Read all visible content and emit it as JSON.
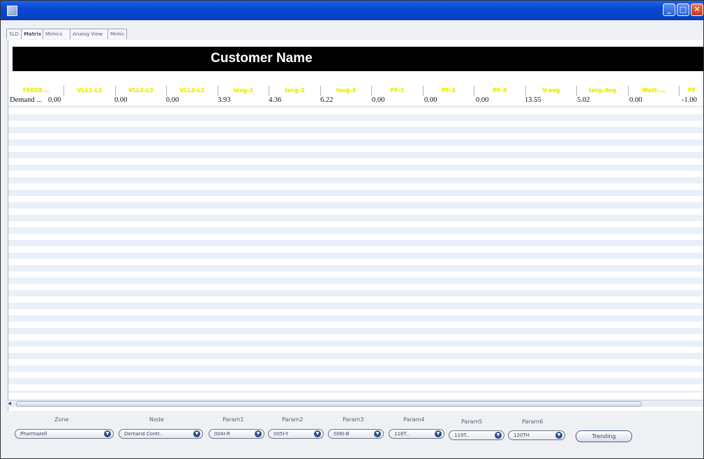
{
  "window": {
    "close_glyph": "✕",
    "min_glyph": "_",
    "max_glyph": "□"
  },
  "tabs": [
    "SLD",
    "Matrix",
    "Mimics",
    "Analog View",
    "Mimic"
  ],
  "active_tab": 1,
  "banner": {
    "title": "Customer Name"
  },
  "table": {
    "columns": [
      "FEEDE...",
      "VLL1-L2",
      "VLL2-L3",
      "VLL3-L1",
      "Iavg-1",
      "Iavg-2",
      "Iavg-3",
      "PF-1",
      "PF-2",
      "PF-3",
      "V-avg",
      "Iavg-Avg",
      "Watt-...",
      "PF"
    ],
    "rows": [
      [
        "Demand ...",
        "0.00",
        "0.00",
        "0.00",
        "3.93",
        "4.36",
        "6.22",
        "0.00",
        "0.00",
        "0.00",
        "13.55",
        "5.02",
        "0.00",
        "-1.00"
      ]
    ]
  },
  "controls": {
    "zone": {
      "label": "Zone",
      "value": "Pharmazell"
    },
    "node": {
      "label": "Node",
      "value": "Demand Contr.."
    },
    "param1": {
      "label": "Param1",
      "value": "004I-R"
    },
    "param2": {
      "label": "Param2",
      "value": "005I-Y"
    },
    "param3": {
      "label": "Param3",
      "value": "006I-B"
    },
    "param4": {
      "label": "Param4",
      "value": "118T.."
    },
    "param5": {
      "label": "Param5",
      "value": "119T.."
    },
    "param6": {
      "label": "Param6",
      "value": "120TH"
    },
    "trending_label": "Trending"
  },
  "colors": {
    "titlebar": "#0a46d2",
    "banner_bg": "#000000",
    "header_text": "#f5f500",
    "row_stripe": "#e9f0f9"
  }
}
